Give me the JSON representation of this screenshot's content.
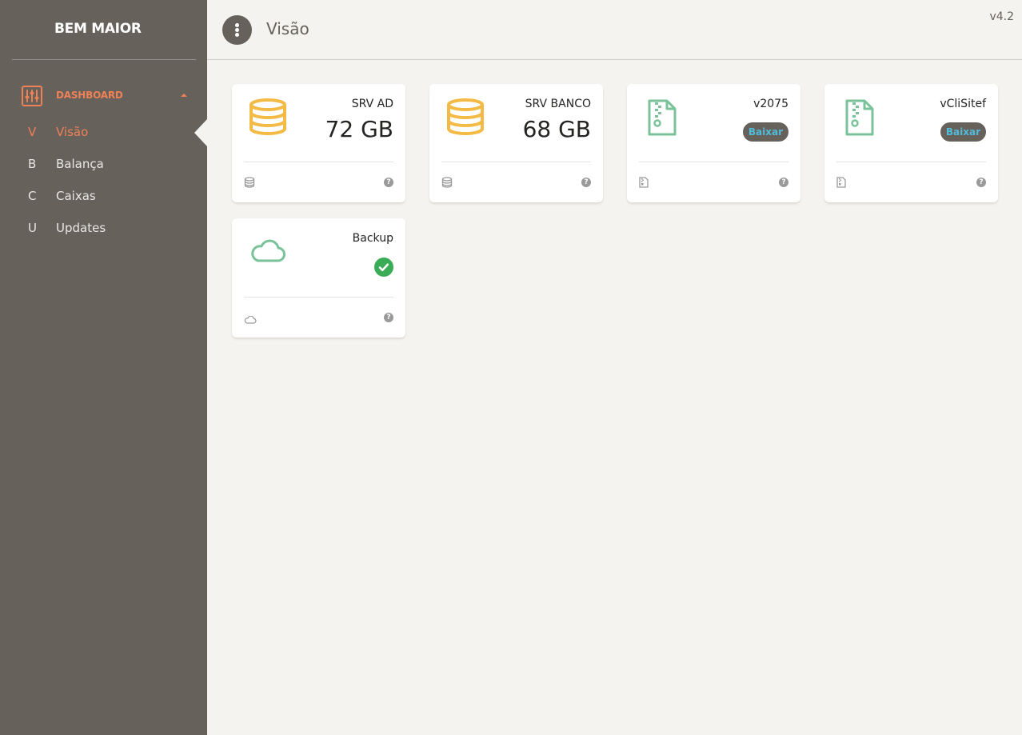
{
  "app": {
    "brand": "BEM MAIOR",
    "version": "v4.2"
  },
  "header": {
    "title": "Visão"
  },
  "sidebar": {
    "section": {
      "label": "DASHBOARD",
      "icon": "sliders-icon"
    },
    "items": [
      {
        "letter": "V",
        "label": "Visão",
        "active": true
      },
      {
        "letter": "B",
        "label": "Balança",
        "active": false
      },
      {
        "letter": "C",
        "label": "Caixas",
        "active": false
      },
      {
        "letter": "U",
        "label": "Updates",
        "active": false
      }
    ]
  },
  "cards": [
    {
      "title": "SRV AD",
      "value": "72 GB",
      "icon": "database-icon"
    },
    {
      "title": "SRV BANCO",
      "value": "68 GB",
      "icon": "database-icon"
    },
    {
      "title": "v2075",
      "action": "Baixar",
      "icon": "file-zip-icon"
    },
    {
      "title": "vCliSitef",
      "action": "Baixar",
      "icon": "file-zip-icon"
    },
    {
      "title": "Backup",
      "status": "ok",
      "icon": "cloud-icon"
    }
  ],
  "help_glyph": "?",
  "colors": {
    "sidebar": "#66615b",
    "accent": "#ef8157",
    "database": "#f3bb45",
    "file": "#7ac29a",
    "badge_text": "#51bcda",
    "success": "#3aac56"
  }
}
